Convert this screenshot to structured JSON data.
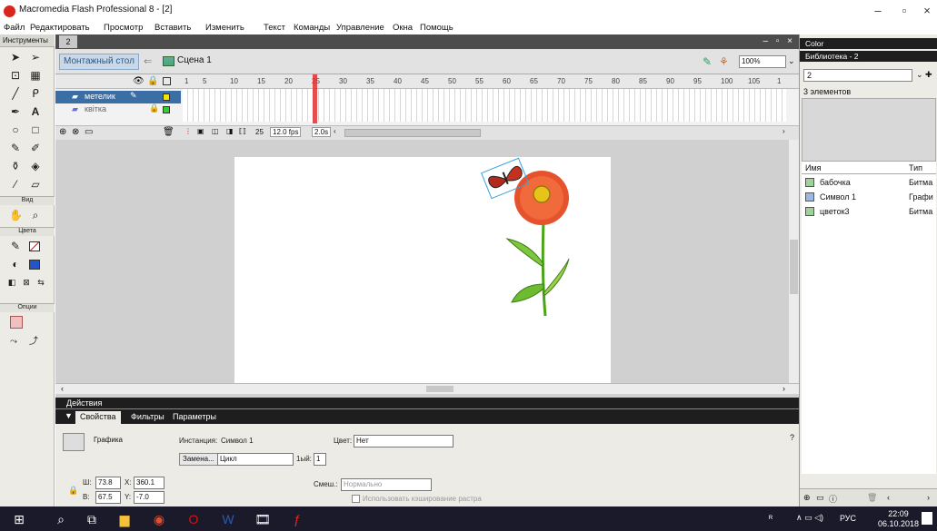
{
  "window": {
    "title": "Macromedia Flash Professional 8 - [2]"
  },
  "menu": [
    "Файл",
    "Редактировать",
    "Просмотр",
    "Вставить",
    "Изменить",
    "Текст",
    "Команды",
    "Управление",
    "Окна",
    "Помощь"
  ],
  "tools": {
    "header": "Инструменты",
    "section_view": "Вид",
    "section_colors": "Цвета",
    "section_options": "Опции"
  },
  "document": {
    "tab": "2",
    "edit_button": "Монтажный стол",
    "scene": "Сцена 1",
    "zoom": "100%"
  },
  "timeline": {
    "ruler": [
      "1",
      "5",
      "10",
      "15",
      "20",
      "25",
      "30",
      "35",
      "40",
      "45",
      "50",
      "55",
      "60",
      "65",
      "70",
      "75",
      "80",
      "85",
      "90",
      "95",
      "100",
      "105",
      "1"
    ],
    "layers": [
      {
        "name": "метелик"
      },
      {
        "name": "квітка"
      }
    ],
    "current_frame": "25",
    "fps": "12.0 fps",
    "time": "2.0s"
  },
  "actions_panel": {
    "title": "Действия"
  },
  "properties": {
    "tabs": [
      "Свойства",
      "Фильтры",
      "Параметры"
    ],
    "type_select": "Графика",
    "instance_label": "Инстанция:",
    "instance_value": "Символ 1",
    "color_label": "Цвет:",
    "color_value": "Нет",
    "swap_button": "Замена...",
    "loop_select": "Цикл",
    "first_label": "1ый:",
    "first_value": "1",
    "w_label": "Ш:",
    "w_value": "73.8",
    "x_label": "X:",
    "x_value": "360.1",
    "h_label": "В:",
    "h_value": "67.5",
    "y_label": "Y:",
    "y_value": "-7.0",
    "blend_label": "Смеш.:",
    "blend_value": "Нормально",
    "cache_label": "Использовать кэширование растра"
  },
  "right_panel": {
    "color_title": "Color",
    "library_title": "Библиотека - 2",
    "library_select": "2",
    "count": "3 элементов",
    "col_name": "Имя",
    "col_type": "Тип",
    "items": [
      {
        "name": "бабочка",
        "type": "Битма"
      },
      {
        "name": "Символ 1",
        "type": "Графи"
      },
      {
        "name": "цветок3",
        "type": "Битма"
      }
    ]
  },
  "taskbar": {
    "lang": "РУС",
    "time": "22:09",
    "date": "06.10.2018"
  }
}
